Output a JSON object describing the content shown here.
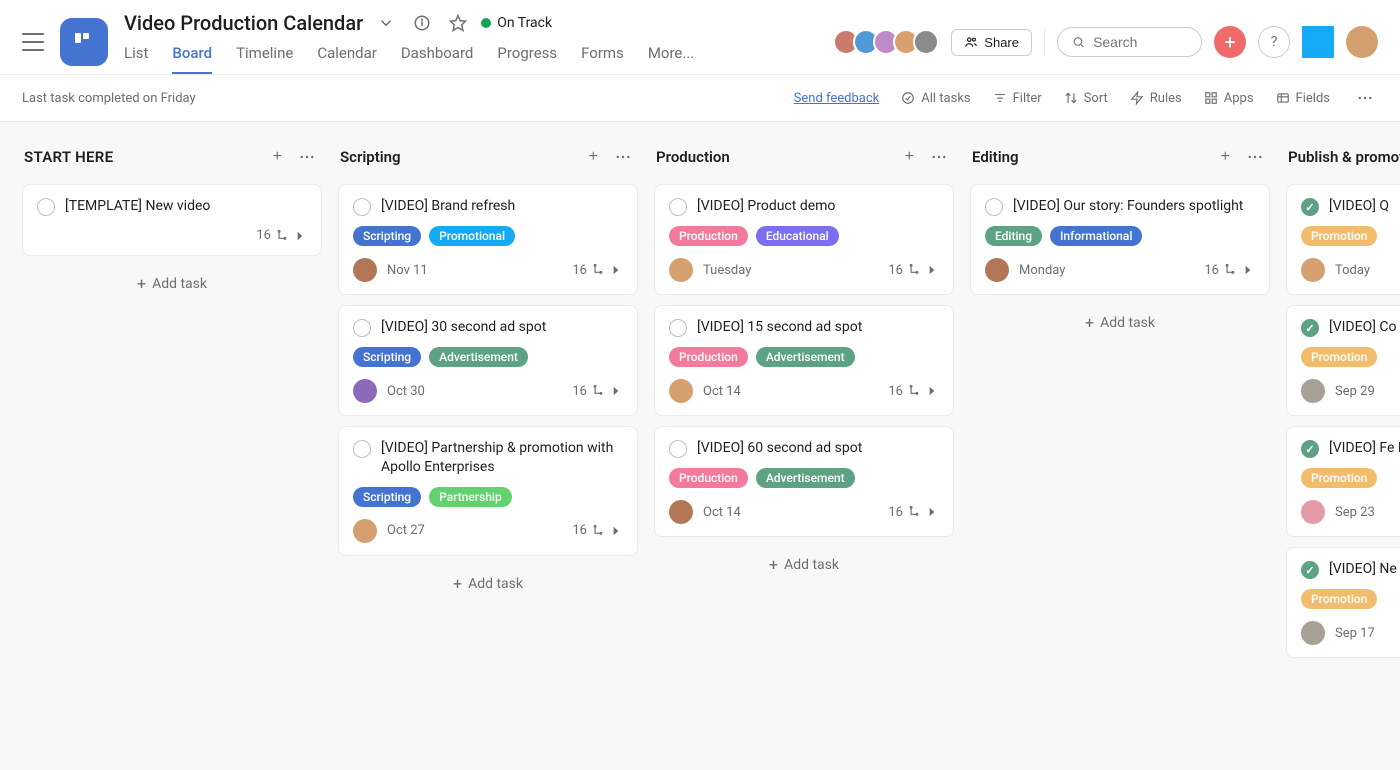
{
  "header": {
    "title": "Video Production Calendar",
    "status_label": "On Track",
    "tabs": [
      "List",
      "Board",
      "Timeline",
      "Calendar",
      "Dashboard",
      "Progress",
      "Forms",
      "More..."
    ],
    "active_tab_index": 1,
    "share_label": "Share",
    "search_placeholder": "Search",
    "help_symbol": "?"
  },
  "toolbar": {
    "completed_note": "Last task completed on Friday",
    "feedback_label": "Send feedback",
    "all_tasks_label": "All tasks",
    "filter_label": "Filter",
    "sort_label": "Sort",
    "rules_label": "Rules",
    "apps_label": "Apps",
    "fields_label": "Fields"
  },
  "common": {
    "add_task_label": "Add task",
    "subtask_count": "16"
  },
  "tag_colors": {
    "Scripting": "#4573d2",
    "Promotional": "#14aaf5",
    "Advertisement": "#5da283",
    "Partnership": "#62d26f",
    "Production": "#f37a9b",
    "Educational": "#7a6ff0",
    "Editing": "#5da283",
    "Informational": "#4573d2",
    "Promotion": "#f1bd6c"
  },
  "avatar_colors": {
    "a1": "#c97b6d",
    "a2": "#4f9ad6",
    "a3": "#bd8cc6",
    "a4": "#d99f6e",
    "a5": "#8b8b8b",
    "brown1": "#b27757",
    "purple1": "#8b6bb7",
    "tan1": "#d5a06f",
    "pink1": "#e59aa8",
    "gray1": "#a8a095"
  },
  "columns": [
    {
      "title": "START HERE",
      "cards": [
        {
          "title": "[TEMPLATE] New video",
          "tags": [],
          "assignee": null,
          "date": null,
          "subtasks": "16"
        }
      ]
    },
    {
      "title": "Scripting",
      "cards": [
        {
          "title": "[VIDEO] Brand refresh",
          "tags": [
            "Scripting",
            "Promotional"
          ],
          "assignee": "brown1",
          "date": "Nov 11",
          "subtasks": "16"
        },
        {
          "title": "[VIDEO] 30 second ad spot",
          "tags": [
            "Scripting",
            "Advertisement"
          ],
          "assignee": "purple1",
          "date": "Oct 30",
          "subtasks": "16"
        },
        {
          "title": "[VIDEO] Partnership & promotion with Apollo Enterprises",
          "tags": [
            "Scripting",
            "Partnership"
          ],
          "assignee": "tan1",
          "date": "Oct 27",
          "subtasks": "16"
        }
      ]
    },
    {
      "title": "Production",
      "cards": [
        {
          "title": "[VIDEO] Product demo",
          "tags": [
            "Production",
            "Educational"
          ],
          "assignee": "tan1",
          "date": "Tuesday",
          "subtasks": "16"
        },
        {
          "title": "[VIDEO] 15 second ad spot",
          "tags": [
            "Production",
            "Advertisement"
          ],
          "assignee": "tan1",
          "date": "Oct 14",
          "subtasks": "16"
        },
        {
          "title": "[VIDEO] 60 second ad spot",
          "tags": [
            "Production",
            "Advertisement"
          ],
          "assignee": "brown1",
          "date": "Oct 14",
          "subtasks": "16"
        }
      ]
    },
    {
      "title": "Editing",
      "cards": [
        {
          "title": "[VIDEO] Our story: Founders spotlight",
          "tags": [
            "Editing",
            "Informational"
          ],
          "assignee": "brown1",
          "date": "Monday",
          "subtasks": "16"
        }
      ]
    },
    {
      "title": "Publish & promote",
      "cards": [
        {
          "title": "[VIDEO] Q",
          "done": true,
          "tags": [
            "Promotion"
          ],
          "assignee": "tan1",
          "date": "Today"
        },
        {
          "title": "[VIDEO] Co Pham",
          "done": true,
          "tags": [
            "Promotion"
          ],
          "assignee": "gray1",
          "date": "Sep 29"
        },
        {
          "title": "[VIDEO] Fe Marketing",
          "done": true,
          "tags": [
            "Promotion"
          ],
          "assignee": "pink1",
          "date": "Sep 23"
        },
        {
          "title": "[VIDEO] Ne announcement",
          "done": true,
          "tags": [
            "Promotion"
          ],
          "assignee": "gray1",
          "date": "Sep 17"
        }
      ]
    }
  ]
}
